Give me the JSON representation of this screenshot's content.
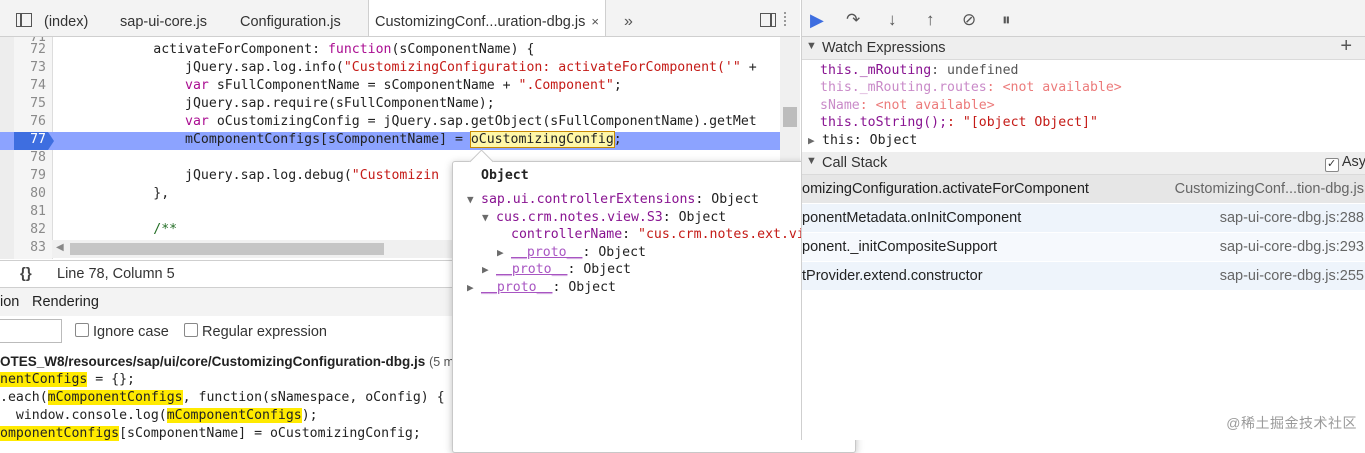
{
  "editor_tabs": {
    "items": [
      "(index)",
      "sap-ui-core.js",
      "Configuration.js",
      "CustomizingConf...uration-dbg.js"
    ],
    "close_glyph": "×",
    "more_glyph": "»"
  },
  "editor": {
    "lines": [
      {
        "n": "72",
        "t": "            activateForComponent: function(sComponentName) {"
      },
      {
        "n": "73",
        "t": "                jQuery.sap.log.info(\"CustomizingConfiguration: activateForComponent('\" +"
      },
      {
        "n": "74",
        "t": "                var sFullComponentName = sComponentName + \".Component\";"
      },
      {
        "n": "75",
        "t": "                jQuery.sap.require(sFullComponentName);"
      },
      {
        "n": "76",
        "t": "                var oCustomizingConfig = jQuery.sap.getObject(sFullComponentName).getMet"
      },
      {
        "n": "77",
        "t": "                mComponentConfigs[sComponentName] = oCustomizingConfig;"
      },
      {
        "n": "78",
        "t": ""
      },
      {
        "n": "79",
        "t": "                jQuery.sap.log.debug(\"Customizin"
      },
      {
        "n": "80",
        "t": "            },"
      },
      {
        "n": "81",
        "t": ""
      },
      {
        "n": "82",
        "t": "            /**"
      },
      {
        "n": "83",
        "t": ""
      }
    ],
    "partial_top": "71"
  },
  "status": {
    "braces": "{}",
    "position": "Line 78, Column 5"
  },
  "drawer": {
    "tabs": [
      "ion",
      "Rendering"
    ],
    "search_options": [
      "Ignore case",
      "Regular expression"
    ],
    "file_path": "OTES_W8/resources/sap/ui/core/CustomizingConfiguration-dbg.js",
    "file_count": "(5 m",
    "results": [
      {
        "pre": "",
        "hit": "nentConfigs",
        "post": " = {};"
      },
      {
        "pre": ".each(",
        "hit": "mComponentConfigs",
        "post": ", function(sNamespace, oConfig) {"
      },
      {
        "pre": "  window.console.log(",
        "hit": "mComponentConfigs",
        "post": ");"
      },
      {
        "pre": "",
        "hit": "omponentConfigs",
        "post": "[sComponentName] = oCustomizingConfig;"
      }
    ]
  },
  "popover": {
    "title": "Object",
    "rows": [
      {
        "indent": 0,
        "tri": "▼",
        "key": "sap.ui.controllerExtensions",
        "val": ": Object",
        "proto": false,
        "str": false
      },
      {
        "indent": 1,
        "tri": "▼",
        "key": "cus.crm.notes.view.S3",
        "val": ": Object",
        "proto": false,
        "str": false
      },
      {
        "indent": 2,
        "tri": "",
        "key": "controllerName",
        "val": "\"cus.crm.notes.ext.vie…",
        "proto": false,
        "str": true
      },
      {
        "indent": 2,
        "tri": "▶",
        "key": "__proto__",
        "val": ": Object",
        "proto": true,
        "str": false
      },
      {
        "indent": 1,
        "tri": "▶",
        "key": "__proto__",
        "val": ": Object",
        "proto": true,
        "str": false
      },
      {
        "indent": 0,
        "tri": "▶",
        "key": "__proto__",
        "val": ": Object",
        "proto": true,
        "str": false
      }
    ]
  },
  "watch": {
    "title": "Watch Expressions",
    "add_glyph": "+",
    "items": [
      {
        "expr": "this._mRouting",
        "val": ": undefined",
        "na": false
      },
      {
        "expr": "this._mRouting.routes",
        "val": ": <not available>",
        "na": true
      },
      {
        "expr": "sName",
        "val": ": <not available>",
        "na": true
      },
      {
        "expr": "this.toString();",
        "val": ": \"[object Object]\"",
        "na": false,
        "strval": true
      },
      {
        "expr": "this",
        "val": ": Object",
        "na": false,
        "tri": "▶"
      }
    ]
  },
  "callstack": {
    "title": "Call Stack",
    "async_label": "Asy",
    "frames": [
      {
        "fn": "omizingConfiguration.activateForComponent",
        "loc": "CustomizingConf...tion-dbg.js",
        "active": true
      },
      {
        "fn": "ponentMetadata.onInitComponent",
        "loc": "sap-ui-core-dbg.js:288"
      },
      {
        "fn": "ponent._initCompositeSupport",
        "loc": "sap-ui-core-dbg.js:293"
      },
      {
        "fn": "tProvider.extend.constructor",
        "loc": "sap-ui-core-dbg.js:255"
      }
    ]
  },
  "watermark": "@稀土掘金技术社区",
  "colors": {
    "exec_line": "#8ca3ff",
    "breakpoint": "#3e6ee0",
    "search_hit": "#ffea00"
  }
}
